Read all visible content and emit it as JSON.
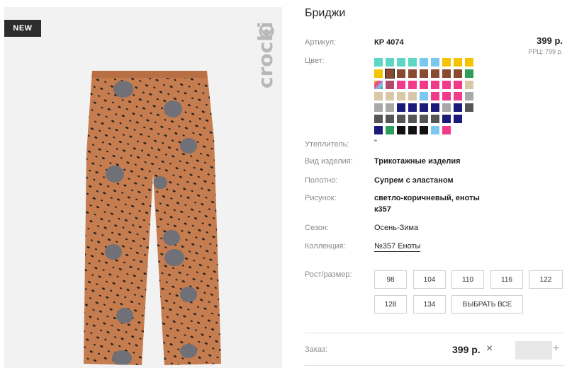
{
  "product": {
    "badge": "NEW",
    "brand": "crockid",
    "title": "Бриджи"
  },
  "details": {
    "article": {
      "label": "Артикул:",
      "value": "КР 4074"
    },
    "price": "399 р.",
    "rrp": "РРЦ: 799 р.",
    "color_label": "Цвет:",
    "insulation": {
      "label": "Утеплитель:",
      "value": "\""
    },
    "product_type": {
      "label": "Вид изделия:",
      "value": "Трикотажные изделия"
    },
    "fabric": {
      "label": "Полотно:",
      "value": "Супрем с эластаном"
    },
    "pattern": {
      "label": "Рисунок:",
      "value_line1": "светло-коричневый, еноты",
      "value_line2": "к357"
    },
    "season": {
      "label": "Сезон:",
      "value": "Осень-Зима"
    },
    "collection": {
      "label": "Коллекция:",
      "value": "№357 Еноты"
    }
  },
  "colors": {
    "rows": [
      [
        "#5ed6c4",
        "#5ed6c4",
        "#5ed6c4",
        "#5ed6c4",
        "#7cc7f0",
        "#7cc7f0",
        "#f5c400",
        "#f5c400",
        "#f5c400"
      ],
      [
        "#f5c400",
        "#8a4a30",
        "#8a4a30",
        "#8a4a30",
        "#8a4a30",
        "#8a4a30",
        "#8a4a30",
        "#8a4a30",
        "#2e9f5a"
      ],
      [
        "rainbow",
        "#b04a6a",
        "#f03a8a",
        "#f03a8a",
        "#f03a8a",
        "#f03a8a",
        "#f03a8a",
        "#f03a8a",
        "#d8c8a8"
      ],
      [
        "#d8c8a8",
        "#d8c8a8",
        "#d8c8a8",
        "#d8c8a8",
        "#7cc7f0",
        "#f03a8a",
        "#f03a8a",
        "#f03a8a",
        "#a8a8a8"
      ],
      [
        "#a8a8a8",
        "#a8a8a8",
        "#1a1a7a",
        "#1a1a7a",
        "#1a1a7a",
        "#1a1a7a",
        "#a8a8a8",
        "#1a1a7a",
        "#555555"
      ],
      [
        "#555555",
        "#555555",
        "#555555",
        "#555555",
        "#555555",
        "#555555",
        "#1a1a7a",
        "#1a1a7a"
      ],
      [
        "#1a1a7a",
        "#2e9f5a",
        "#111111",
        "#111111",
        "#111111",
        "#7cc7f0",
        "#f03a8a"
      ]
    ],
    "selected": "1-1"
  },
  "sizes": {
    "label": "Рост/размер:",
    "options": [
      "98",
      "104",
      "110",
      "116",
      "122",
      "128",
      "134"
    ],
    "select_all": "ВЫБРАТЬ ВСЕ"
  },
  "order": {
    "label": "Заказ:",
    "price": "399 р.",
    "remove": "×",
    "add": "+",
    "quantity": ""
  }
}
